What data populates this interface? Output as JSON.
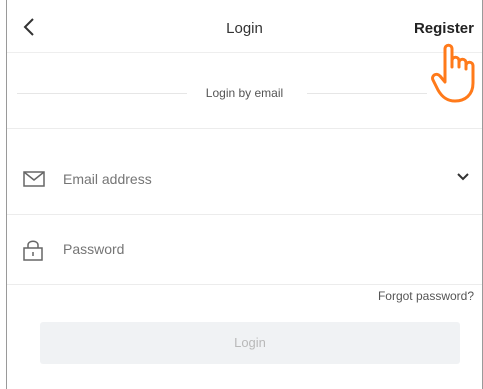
{
  "header": {
    "title": "Login",
    "register_label": "Register",
    "back_icon": "chevron-left-icon",
    "cursor_icon": "hand-pointer-icon"
  },
  "section": {
    "label": "Login by email"
  },
  "email": {
    "icon": "envelope-icon",
    "placeholder": "Email address",
    "dropdown_icon": "chevron-down-icon"
  },
  "password": {
    "icon": "lock-icon",
    "placeholder": "Password"
  },
  "forgot_label": "Forgot password?",
  "login_label": "Login",
  "colors": {
    "accent_hand": "#ff7a1a",
    "disabled_button": "#f0f2f4",
    "placeholder": "#b6b6b6"
  }
}
